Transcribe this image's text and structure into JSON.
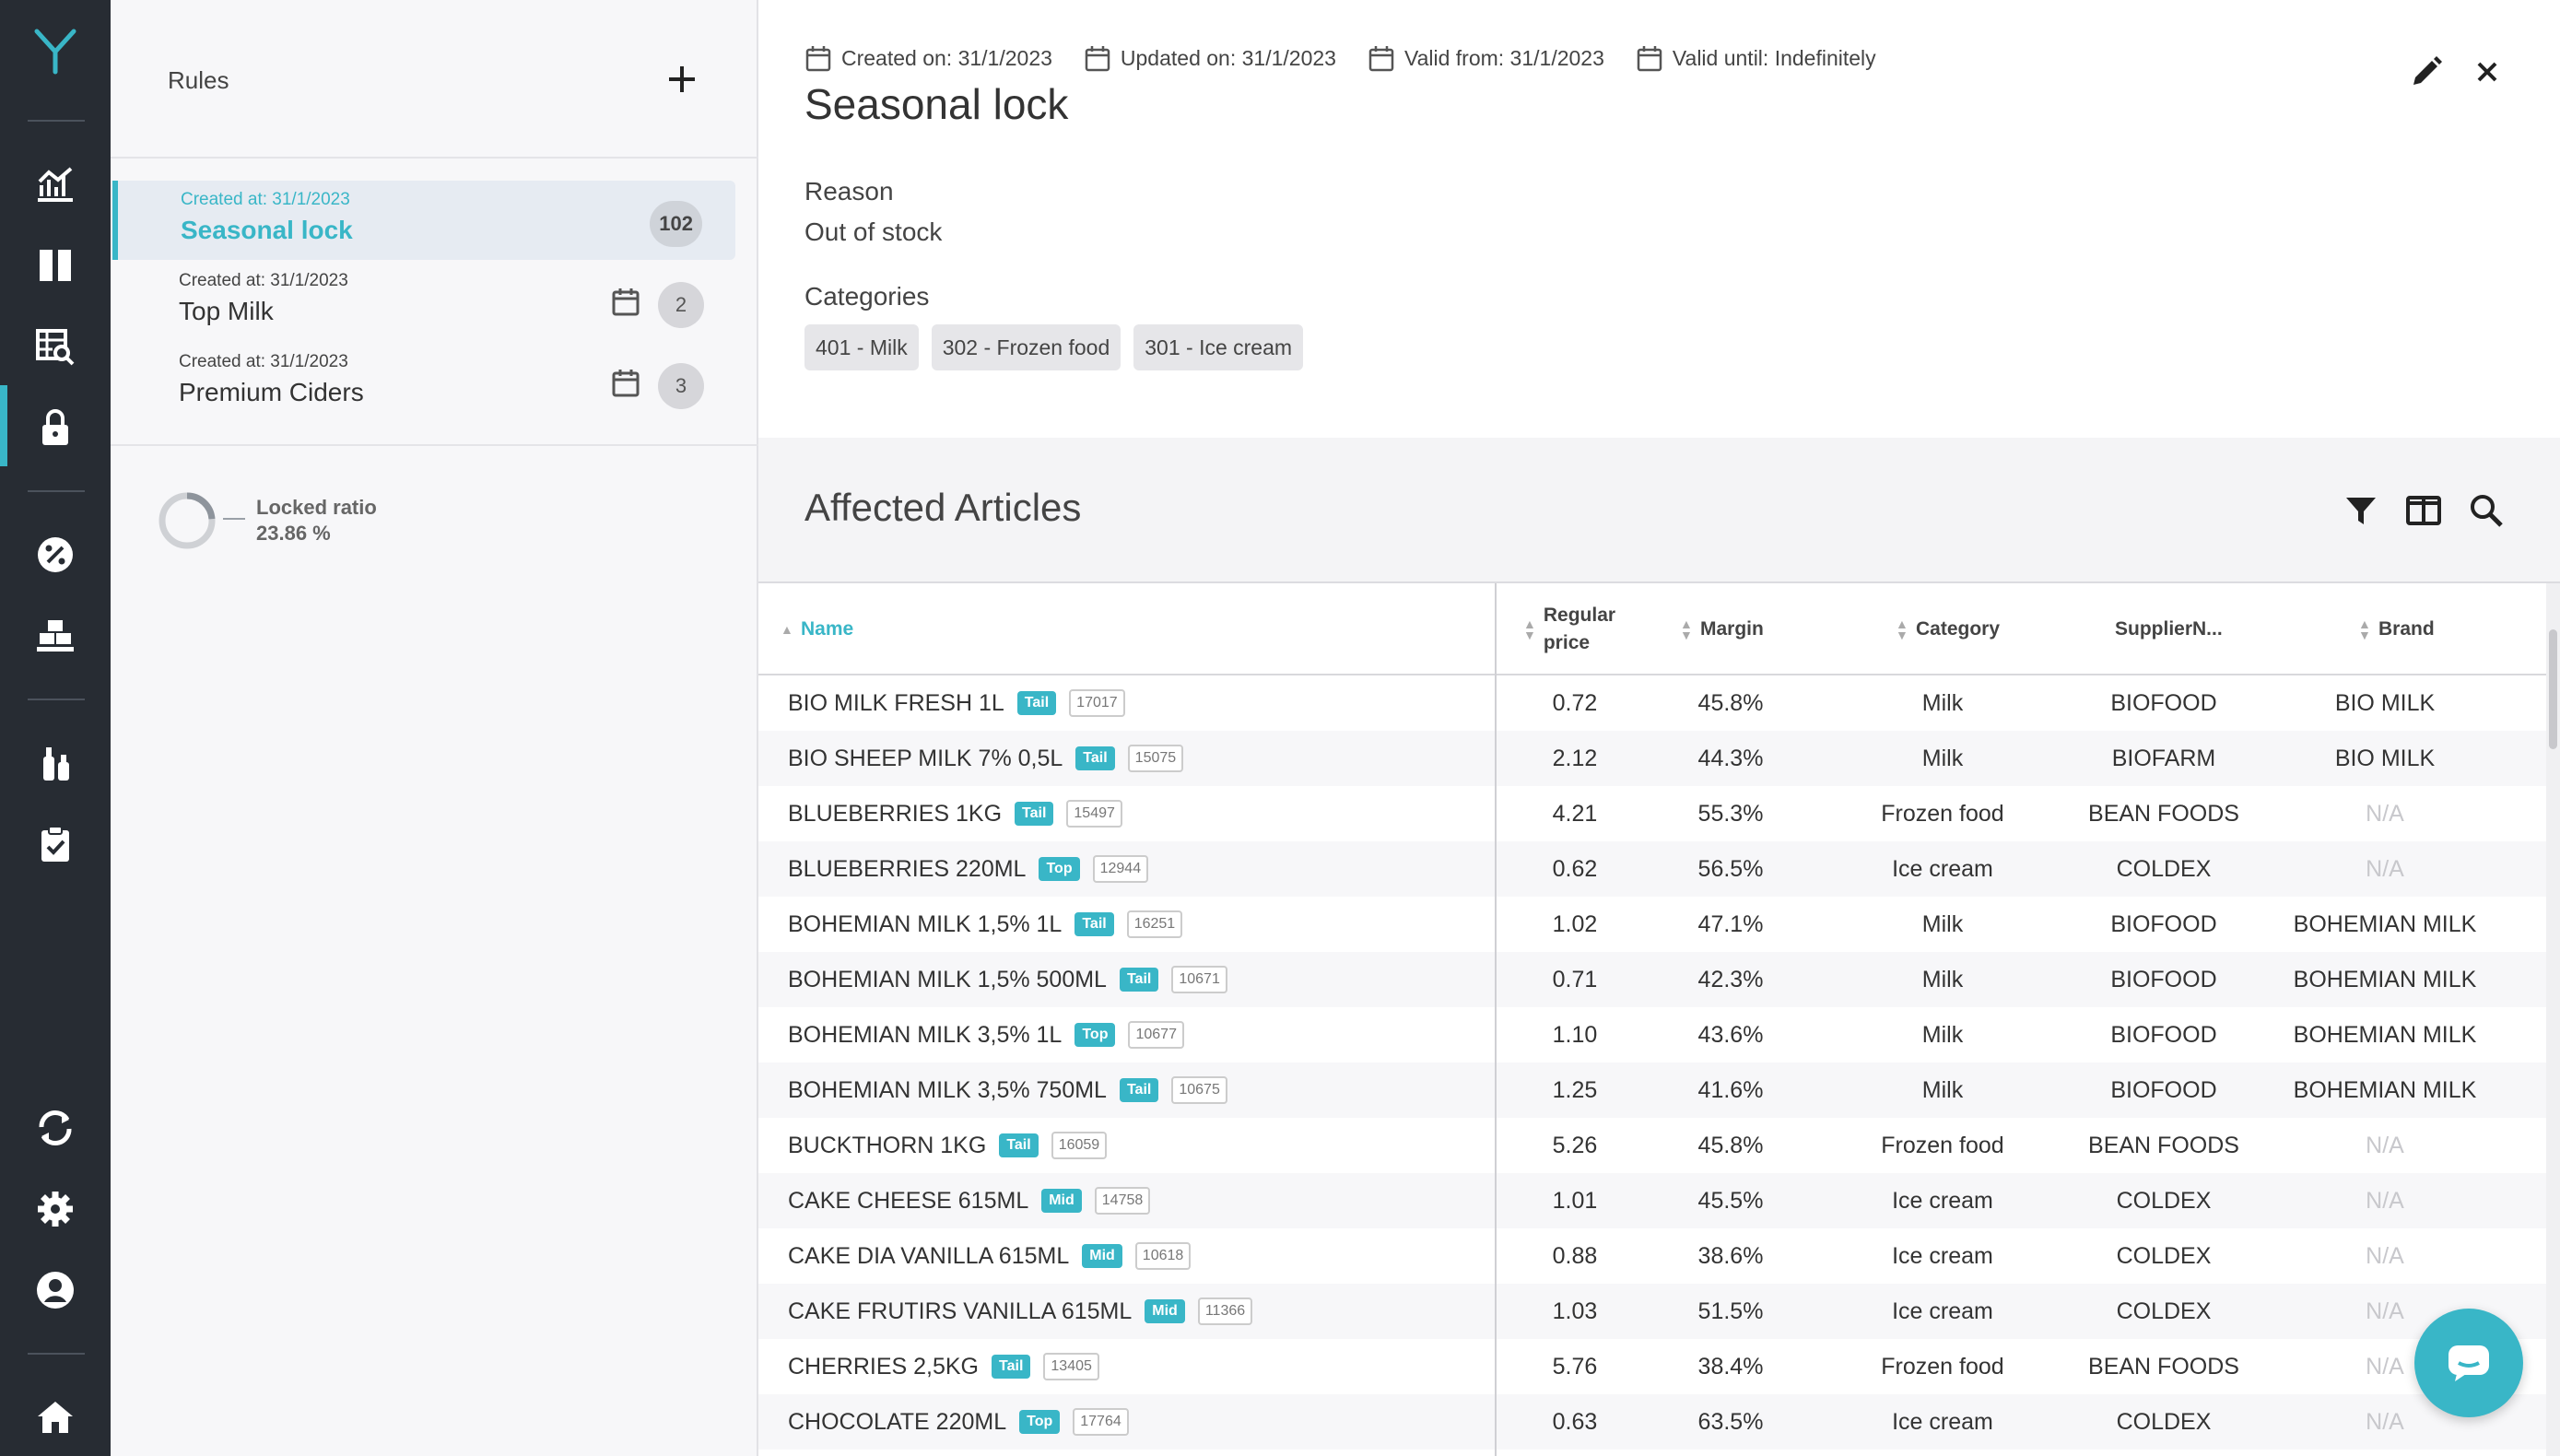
{
  "nav": {
    "logo": "Y",
    "icons": [
      "analytics-icon",
      "columns-icon",
      "table-search-icon",
      "lock-icon",
      "discount-icon",
      "pallets-icon",
      "bottles-icon",
      "clipboard-check-icon",
      "refresh-icon",
      "settings-icon",
      "user-icon",
      "home-icon"
    ]
  },
  "rules": {
    "title": "Rules",
    "items": [
      {
        "meta": "Created at: 31/1/2023",
        "name": "Seasonal lock",
        "count": "102",
        "active": true
      },
      {
        "meta": "Created at: 31/1/2023",
        "name": "Top Milk",
        "count": "2",
        "active": false
      },
      {
        "meta": "Created at: 31/1/2023",
        "name": "Premium Ciders",
        "count": "3",
        "active": false
      }
    ],
    "locked_ratio_label": "Locked ratio",
    "locked_ratio_value": "23.86 %",
    "locked_ratio_fraction": 0.2386
  },
  "detail": {
    "created": "Created on: 31/1/2023",
    "updated": "Updated on: 31/1/2023",
    "valid_from": "Valid from: 31/1/2023",
    "valid_until": "Valid until: Indefinitely",
    "title": "Seasonal lock",
    "reason_label": "Reason",
    "reason_value": "Out of stock",
    "categories_label": "Categories",
    "categories": [
      "401 - Milk",
      "302 - Frozen food",
      "301 - Ice cream"
    ]
  },
  "articles": {
    "title": "Affected Articles",
    "columns": [
      "Name",
      "Regular price",
      "Margin",
      "Category",
      "SupplierN...",
      "Brand"
    ],
    "rows": [
      {
        "name": "BIO MILK FRESH 1L",
        "tag": "Tail",
        "code": "17017",
        "price": "0.72",
        "margin": "45.8%",
        "category": "Milk",
        "supplier": "BIOFOOD",
        "brand": "BIO MILK"
      },
      {
        "name": "BIO SHEEP MILK 7% 0,5L",
        "tag": "Tail",
        "code": "15075",
        "price": "2.12",
        "margin": "44.3%",
        "category": "Milk",
        "supplier": "BIOFARM",
        "brand": "BIO MILK"
      },
      {
        "name": "BLUEBERRIES 1KG",
        "tag": "Tail",
        "code": "15497",
        "price": "4.21",
        "margin": "55.3%",
        "category": "Frozen food",
        "supplier": "BEAN FOODS",
        "brand": "N/A"
      },
      {
        "name": "BLUEBERRIES 220ML",
        "tag": "Top",
        "code": "12944",
        "price": "0.62",
        "margin": "56.5%",
        "category": "Ice cream",
        "supplier": "COLDEX",
        "brand": "N/A"
      },
      {
        "name": "BOHEMIAN MILK 1,5% 1L",
        "tag": "Tail",
        "code": "16251",
        "price": "1.02",
        "margin": "47.1%",
        "category": "Milk",
        "supplier": "BIOFOOD",
        "brand": "BOHEMIAN MILK"
      },
      {
        "name": "BOHEMIAN MILK 1,5% 500ML",
        "tag": "Tail",
        "code": "10671",
        "price": "0.71",
        "margin": "42.3%",
        "category": "Milk",
        "supplier": "BIOFOOD",
        "brand": "BOHEMIAN MILK"
      },
      {
        "name": "BOHEMIAN MILK 3,5% 1L",
        "tag": "Top",
        "code": "10677",
        "price": "1.10",
        "margin": "43.6%",
        "category": "Milk",
        "supplier": "BIOFOOD",
        "brand": "BOHEMIAN MILK"
      },
      {
        "name": "BOHEMIAN MILK 3,5% 750ML",
        "tag": "Tail",
        "code": "10675",
        "price": "1.25",
        "margin": "41.6%",
        "category": "Milk",
        "supplier": "BIOFOOD",
        "brand": "BOHEMIAN MILK"
      },
      {
        "name": "BUCKTHORN 1KG",
        "tag": "Tail",
        "code": "16059",
        "price": "5.26",
        "margin": "45.8%",
        "category": "Frozen food",
        "supplier": "BEAN FOODS",
        "brand": "N/A"
      },
      {
        "name": "CAKE CHEESE 615ML",
        "tag": "Mid",
        "code": "14758",
        "price": "1.01",
        "margin": "45.5%",
        "category": "Ice cream",
        "supplier": "COLDEX",
        "brand": "N/A"
      },
      {
        "name": "CAKE DIA VANILLA 615ML",
        "tag": "Mid",
        "code": "10618",
        "price": "0.88",
        "margin": "38.6%",
        "category": "Ice cream",
        "supplier": "COLDEX",
        "brand": "N/A"
      },
      {
        "name": "CAKE FRUTIRS VANILLA 615ML",
        "tag": "Mid",
        "code": "11366",
        "price": "1.03",
        "margin": "51.5%",
        "category": "Ice cream",
        "supplier": "COLDEX",
        "brand": "N/A"
      },
      {
        "name": "CHERRIES 2,5KG",
        "tag": "Tail",
        "code": "13405",
        "price": "5.76",
        "margin": "38.4%",
        "category": "Frozen food",
        "supplier": "BEAN FOODS",
        "brand": "N/A"
      },
      {
        "name": "CHOCOLATE 220ML",
        "tag": "Top",
        "code": "17764",
        "price": "0.63",
        "margin": "63.5%",
        "category": "Ice cream",
        "supplier": "COLDEX",
        "brand": "N/A"
      }
    ]
  },
  "colors": {
    "accent": "#39b6c7",
    "nav_bg": "#272c33"
  }
}
